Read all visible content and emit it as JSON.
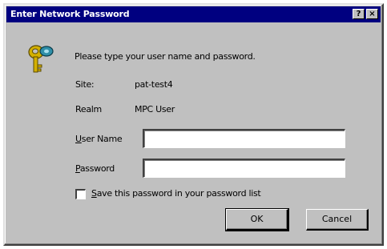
{
  "window": {
    "title": "Enter Network Password",
    "help_button": "?",
    "close_button": "×"
  },
  "dialog": {
    "prompt": "Please type your user name and password.",
    "site_label": "Site:",
    "site_value": "pat-test4",
    "realm_label": "Realm",
    "realm_value": "MPC User",
    "user_name_label_accel": "U",
    "user_name_label_rest": "ser Name",
    "password_label_accel": "P",
    "password_label_rest": "assword",
    "user_name_value": "",
    "password_value": "",
    "save_password_accel": "S",
    "save_password_rest": "ave this password in your password list",
    "save_password_checked": false
  },
  "buttons": {
    "ok": "OK",
    "cancel": "Cancel"
  },
  "icons": {
    "prompt_icon": "key-icon"
  },
  "colors": {
    "titlebar": "#000080",
    "face": "#c0c0c0",
    "key_gold": "#d4b000"
  }
}
